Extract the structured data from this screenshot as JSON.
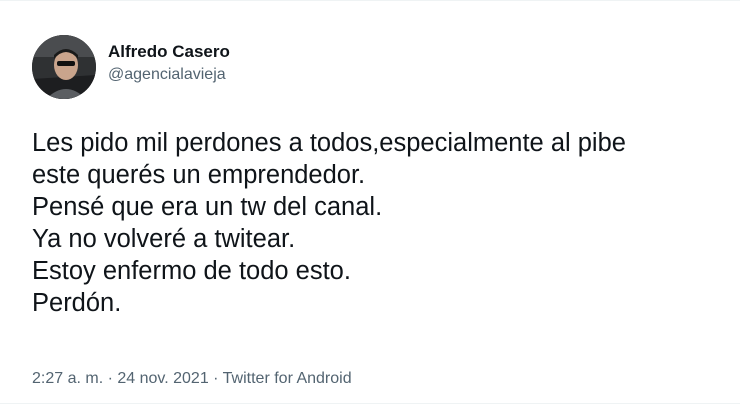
{
  "tweet": {
    "author": {
      "display_name": "Alfredo Casero",
      "handle": "@agencialavieja",
      "avatar_icon": "profile-photo"
    },
    "text_lines": [
      "Les pido mil perdones a todos,especialmente al pibe",
      "este querés un emprendedor.",
      "Pensé que era un tw del canal.",
      "Ya no volveré a twitear.",
      "Estoy enfermo de todo esto.",
      "Perdón."
    ],
    "meta": {
      "time": "2:27 a. m.",
      "separator": " · ",
      "date": "24 nov. 2021",
      "source": "Twitter for Android"
    }
  },
  "colors": {
    "text_primary": "#0f1419",
    "text_secondary": "#536471",
    "divider": "#eff3f4"
  }
}
